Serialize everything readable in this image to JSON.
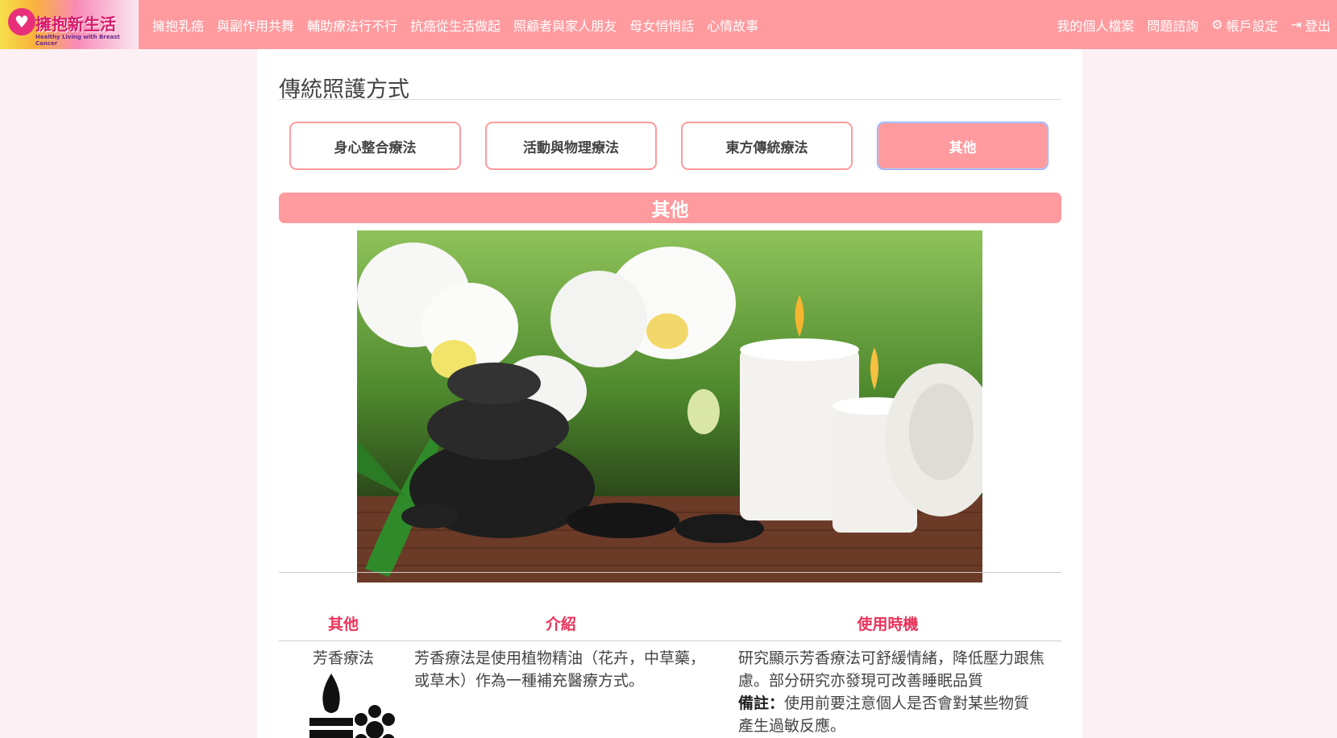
{
  "brand": {
    "name": "擁抱新生活",
    "tagline": "Healthy Living with Breast Cancer"
  },
  "nav": {
    "left": [
      "擁抱乳癌",
      "與副作用共舞",
      "輔助療法行不行",
      "抗癌從生活做起",
      "照顧者與家人朋友",
      "母女悄悄話",
      "心情故事"
    ],
    "profile": "我的個人檔案",
    "consult": "問題諮詢",
    "settings": "帳戶設定",
    "logout": "登出"
  },
  "page": {
    "title": "傳統照護方式"
  },
  "tabs": [
    "身心整合療法",
    "活動與物理療法",
    "東方傳統療法",
    "其他"
  ],
  "active_tab": 3,
  "section": {
    "title": "其他"
  },
  "table": {
    "headers": [
      "其他",
      "介紹",
      "使用時機"
    ],
    "rows": [
      {
        "name": "芳香療法",
        "intro": "芳香療法是使用植物精油（花卉，中草藥，或草木）作為一種補充醫療方式。",
        "timing": "研究顯示芳香療法可舒緩情緒，降低壓力跟焦慮。部分研究亦發現可改善睡眠品質",
        "note_label": "備註：",
        "note": "使用前要注意個人是否會對某些物質產生過敏反應。"
      }
    ]
  },
  "colors": {
    "accent": "#ff9a9e",
    "header_text": "#e8335a",
    "page_bg": "#fdf0f5"
  }
}
